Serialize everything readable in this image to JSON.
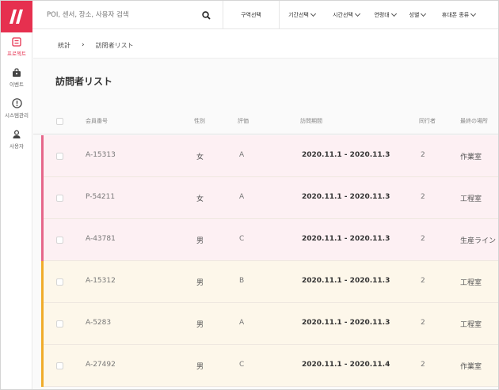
{
  "colors": {
    "brand": "#e6304f",
    "row_pink_bg": "#fdf0f3",
    "row_pink_bar": "#e6668a",
    "row_yellow_bg": "#fdf7ea",
    "row_yellow_bar": "#f0ac2a"
  },
  "sidebar": {
    "items": [
      {
        "label": "프로젝트",
        "icon": "project-icon",
        "active": true
      },
      {
        "label": "이벤트",
        "icon": "bag-icon",
        "active": false
      },
      {
        "label": "시스템관리",
        "icon": "alert-icon",
        "active": false
      },
      {
        "label": "사용자",
        "icon": "user-icon",
        "active": false
      }
    ]
  },
  "topbar": {
    "search_placeholder": "POI, 센서, 장소, 사용자 검색",
    "filters": [
      "구역선택",
      "기간선택",
      "시간선택",
      "연령대",
      "성별",
      "휴대폰 종류"
    ]
  },
  "breadcrumb": [
    "統計",
    "訪問者リスト"
  ],
  "page_title": "訪問者リスト",
  "table": {
    "headers": [
      "会員番号",
      "性別",
      "評価",
      "訪問期間",
      "同行者",
      "最終の場所"
    ],
    "rows": [
      {
        "id": "A-15313",
        "gender": "女",
        "grade": "A",
        "period": "2020.11.1 - 2020.11.3",
        "companions": "2",
        "place": "作業室",
        "tone": "pink"
      },
      {
        "id": "P-54211",
        "gender": "女",
        "grade": "A",
        "period": "2020.11.1 - 2020.11.3",
        "companions": "2",
        "place": "工程室",
        "tone": "pink"
      },
      {
        "id": "A-43781",
        "gender": "男",
        "grade": "C",
        "period": "2020.11.1 - 2020.11.3",
        "companions": "2",
        "place": "生産ライン",
        "tone": "pink"
      },
      {
        "id": "A-15312",
        "gender": "男",
        "grade": "B",
        "period": "2020.11.1 - 2020.11.3",
        "companions": "2",
        "place": "工程室",
        "tone": "yellow"
      },
      {
        "id": "A-5283",
        "gender": "男",
        "grade": "A",
        "period": "2020.11.1 - 2020.11.3",
        "companions": "2",
        "place": "工程室",
        "tone": "yellow"
      },
      {
        "id": "A-27492",
        "gender": "男",
        "grade": "C",
        "period": "2020.11.1 - 2020.11.4",
        "companions": "2",
        "place": "作業室",
        "tone": "yellow"
      }
    ]
  }
}
